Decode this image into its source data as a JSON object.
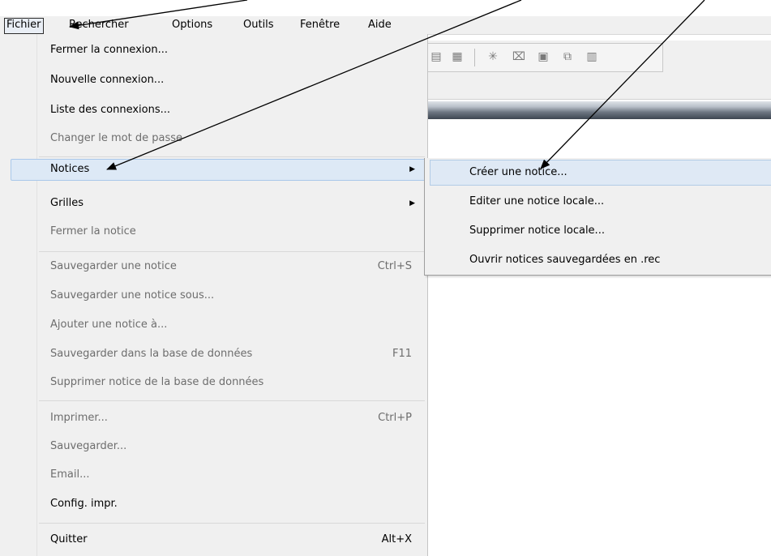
{
  "menubar": {
    "items": [
      {
        "label": "Fichier"
      },
      {
        "label": "Rechercher"
      },
      {
        "label": "Options"
      },
      {
        "label": "Outils"
      },
      {
        "label": "Fenêtre"
      },
      {
        "label": "Aide"
      }
    ]
  },
  "toolbar": {
    "icons": [
      "record-icon",
      "record-copy-icon",
      "asterisk-icon",
      "close-record-icon",
      "grid-icon",
      "link-icon",
      "counter-icon"
    ]
  },
  "file_menu": {
    "items": [
      {
        "label": "Fermer la connexion...",
        "enabled": true
      },
      {
        "label": "Nouvelle connexion...",
        "enabled": true
      },
      {
        "label": "Liste des connexions...",
        "enabled": true
      },
      {
        "label": "Changer le mot de passe",
        "enabled": false
      },
      {
        "label": "Notices",
        "enabled": true,
        "submenu": true,
        "highlighted": true
      },
      {
        "label": "Grilles",
        "enabled": true,
        "submenu": true
      },
      {
        "label": "Fermer la notice",
        "enabled": false
      },
      {
        "label": "Sauvegarder une notice",
        "shortcut": "Ctrl+S",
        "enabled": false
      },
      {
        "label": "Sauvegarder une notice sous...",
        "enabled": false
      },
      {
        "label": "Ajouter une notice à...",
        "enabled": false
      },
      {
        "label": "Sauvegarder dans la base de données",
        "shortcut": "F11",
        "enabled": false
      },
      {
        "label": "Supprimer notice de la base de données",
        "enabled": false
      },
      {
        "label": "Imprimer...",
        "shortcut": "Ctrl+P",
        "enabled": false
      },
      {
        "label": "Sauvegarder...",
        "enabled": false
      },
      {
        "label": "Email...",
        "enabled": false
      },
      {
        "label": "Config. impr.",
        "enabled": true
      },
      {
        "label": "Quitter",
        "shortcut": "Alt+X",
        "enabled": true
      }
    ]
  },
  "notices_submenu": {
    "items": [
      {
        "label": "Créer une notice...",
        "highlighted": true
      },
      {
        "label": "Editer une notice locale..."
      },
      {
        "label": "Supprimer notice locale..."
      },
      {
        "label": "Ouvrir notices sauvegardées en .rec"
      }
    ]
  },
  "colors": {
    "menu_bg": "#f0f0f0",
    "highlight": "#dde9f6",
    "highlight_border": "#a9c8ea",
    "disabled_text": "#6d6d6d"
  }
}
